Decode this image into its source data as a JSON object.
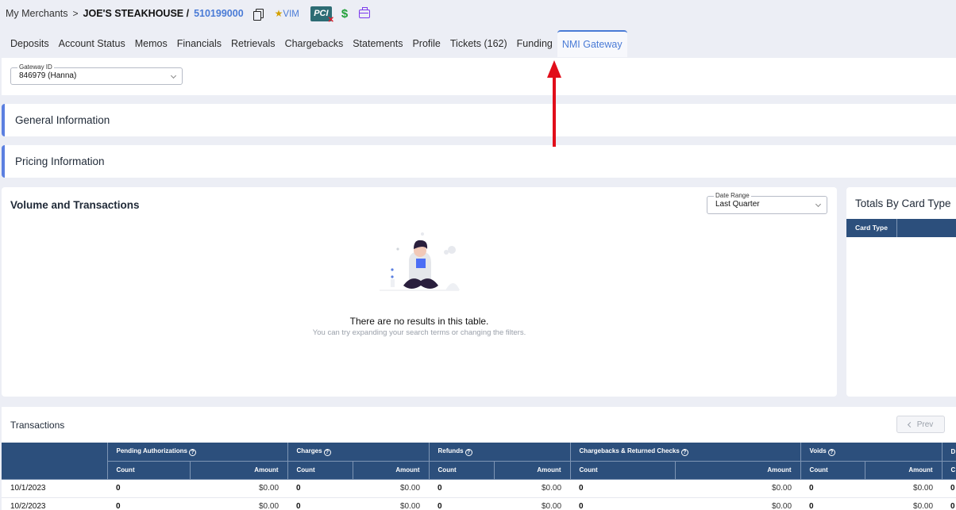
{
  "breadcrumb": {
    "root": "My Merchants",
    "separator": ">",
    "merchant_name": "JOE'S STEAKHOUSE /",
    "merchant_id": "510199000",
    "vim_star": "★",
    "vim_label": "VIM",
    "pci_label": "PCI",
    "pci_mark": "✕",
    "dollar": "$"
  },
  "tabs": [
    {
      "label": "Deposits"
    },
    {
      "label": "Account Status"
    },
    {
      "label": "Memos"
    },
    {
      "label": "Financials"
    },
    {
      "label": "Retrievals"
    },
    {
      "label": "Chargebacks"
    },
    {
      "label": "Statements"
    },
    {
      "label": "Profile"
    },
    {
      "label": "Tickets (162)"
    },
    {
      "label": "Funding"
    },
    {
      "label": "NMI Gateway"
    }
  ],
  "gateway": {
    "legend": "Gateway ID",
    "value": "846979 (Hanna)"
  },
  "sections": {
    "general": "General Information",
    "pricing": "Pricing Information"
  },
  "volume": {
    "title": "Volume and Transactions",
    "date_range_legend": "Date Range",
    "date_range_value": "Last Quarter",
    "empty_title": "There are no results in this table.",
    "empty_subtitle": "You can try expanding your search terms or changing the filters."
  },
  "totals": {
    "title": "Totals By Card Type",
    "col_card_type": "Card Type"
  },
  "transactions": {
    "title": "Transactions",
    "prev": "Prev",
    "groups": [
      "Pending Authorizations",
      "Charges",
      "Refunds",
      "Chargebacks & Returned Checks",
      "Voids",
      "D"
    ],
    "count_label": "Count",
    "amount_label": "Amount",
    "count_cut": "C",
    "help": "?",
    "rows": [
      {
        "date": "10/1/2023",
        "pa_count": "0",
        "pa_amount": "$0.00",
        "ch_count": "0",
        "ch_amount": "$0.00",
        "rf_count": "0",
        "rf_amount": "$0.00",
        "cb_count": "0",
        "cb_amount": "$0.00",
        "vd_count": "0",
        "vd_amount": "$0.00",
        "d": "0"
      },
      {
        "date": "10/2/2023",
        "pa_count": "0",
        "pa_amount": "$0.00",
        "ch_count": "0",
        "ch_amount": "$0.00",
        "rf_count": "0",
        "rf_amount": "$0.00",
        "cb_count": "0",
        "cb_amount": "$0.00",
        "vd_count": "0",
        "vd_amount": "$0.00",
        "d": "0"
      }
    ]
  },
  "colors": {
    "accent": "#4a7bd6",
    "table_header": "#2c4f7c",
    "annotation_arrow": "#e10e1a"
  }
}
